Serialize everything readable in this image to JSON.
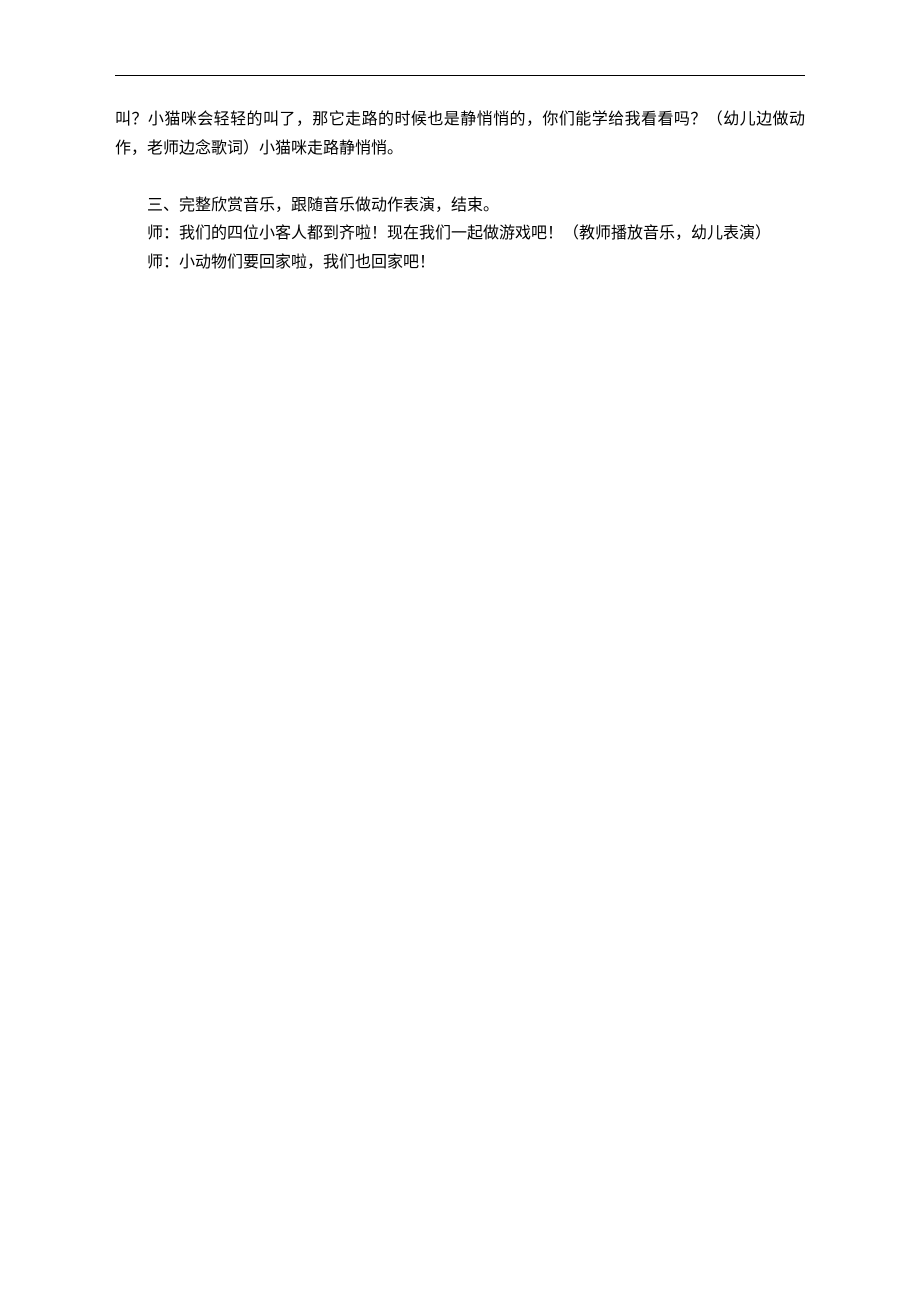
{
  "document": {
    "para1": "叫？小猫咪会轻轻的叫了，那它走路的时候也是静悄悄的，你们能学给我看看吗？（幼儿边做动作，老师边念歌词）小猫咪走路静悄悄。",
    "section_title": "三、完整欣赏音乐，跟随音乐做动作表演，结束。",
    "line1": "师：我们的四位小客人都到齐啦！现在我们一起做游戏吧！（教师播放音乐，幼儿表演）",
    "line2": "师：小动物们要回家啦，我们也回家吧！"
  }
}
